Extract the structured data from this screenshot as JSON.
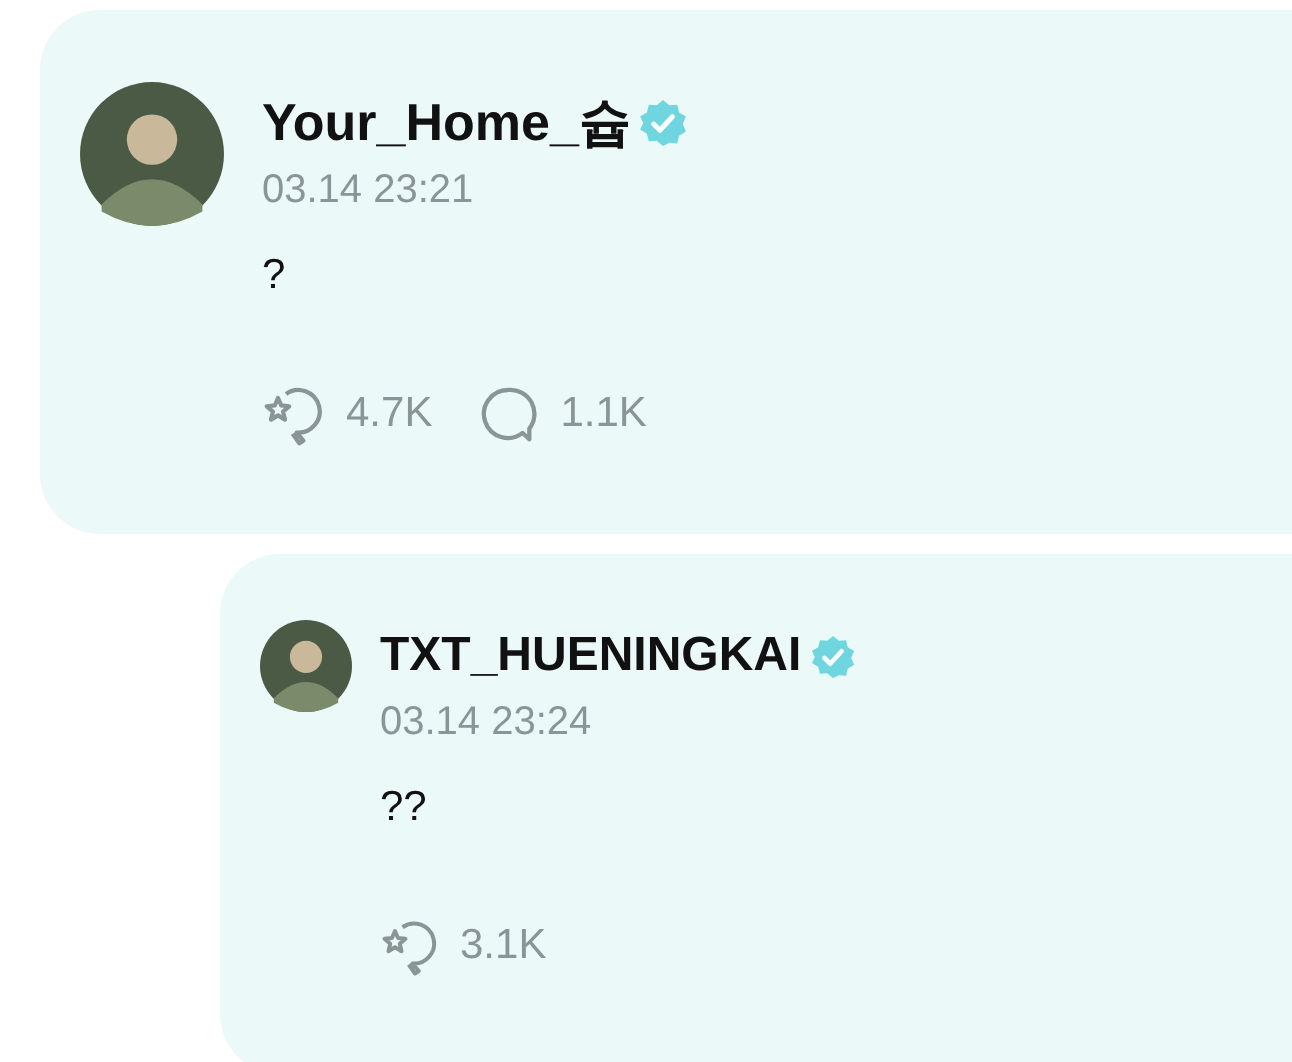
{
  "posts": [
    {
      "author": "Your_Home_슙",
      "verified": true,
      "time": "03.14 23:21",
      "text": "?",
      "stats": [
        {
          "kind": "cheer",
          "count": "4.7K"
        },
        {
          "kind": "comment",
          "count": "1.1K"
        }
      ]
    },
    {
      "author": "TXT_HUENINGKAI",
      "verified": true,
      "time": "03.14 23:24",
      "text": "??",
      "stats": [
        {
          "kind": "cheer",
          "count": "3.1K"
        }
      ]
    }
  ]
}
